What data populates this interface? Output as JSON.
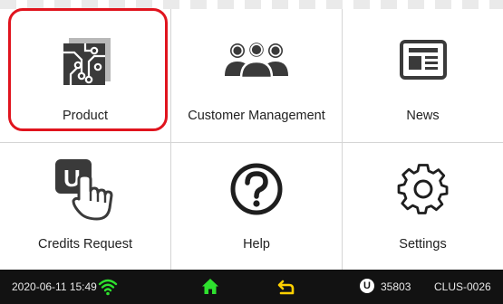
{
  "tiles": [
    {
      "id": "product",
      "label": "Product",
      "icon": "circuit-board-icon"
    },
    {
      "id": "customer-management",
      "label": "Customer Management",
      "icon": "users-group-icon"
    },
    {
      "id": "news",
      "label": "News",
      "icon": "newspaper-icon"
    },
    {
      "id": "credits-request",
      "label": "Credits Request",
      "icon": "credit-hand-icon"
    },
    {
      "id": "help",
      "label": "Help",
      "icon": "question-circle-icon"
    },
    {
      "id": "settings",
      "label": "Settings",
      "icon": "gear-icon"
    }
  ],
  "statusbar": {
    "datetime": "2020-06-11 15:49",
    "credit_badge": "U",
    "credits": "35803",
    "device_id": "CLUS-0026"
  },
  "colors": {
    "highlight": "#e0141e",
    "icon_dark": "#3a3a3a",
    "statusbar_bg": "#121212",
    "wifi": "#2ee02e",
    "home": "#2ee02e",
    "back": "#ffd000"
  },
  "icons": {
    "credits_tile_glyph": "U"
  }
}
